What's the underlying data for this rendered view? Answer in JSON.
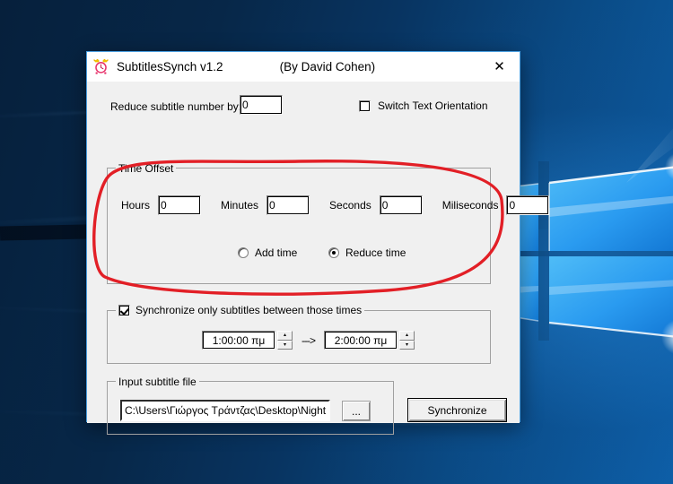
{
  "window": {
    "title": "SubtitlesSynch v1.2",
    "author": "(By David Cohen)",
    "icon": "alarm-clock-icon",
    "close_label": "✕"
  },
  "form": {
    "reduce_subtitle_label": "Reduce subtitle number by:",
    "reduce_subtitle_value": "0",
    "switch_orientation_label": "Switch Text Orientation",
    "switch_orientation_checked": false
  },
  "time_offset": {
    "group_title": "Time Offset",
    "fields": [
      {
        "label": "Hours",
        "value": "0"
      },
      {
        "label": "Minutes",
        "value": "0"
      },
      {
        "label": "Seconds",
        "value": "0"
      },
      {
        "label": "Miliseconds",
        "value": "0"
      }
    ],
    "radio_add_label": "Add time",
    "radio_reduce_label": "Reduce time",
    "selected": "Reduce time"
  },
  "sync_range": {
    "checkbox_label": "Synchronize only subtitles between those times",
    "checked": true,
    "start_time": "1:00:00 πμ",
    "end_time": "2:00:00 πμ",
    "arrow": "--->",
    "spin_up": "▴",
    "spin_down": "▾"
  },
  "input_file": {
    "group_title": "Input subtitle file",
    "path": "C:\\Users\\Γιώργος Τράντζας\\Desktop\\Night Ol",
    "browse_label": "...",
    "synchronize_label": "Synchronize"
  },
  "annotation": {
    "shape": "red-ellipse-highlight",
    "target": "Time Offset",
    "color": "#e21f26"
  },
  "desktop": {
    "wallpaper": "windows-10-hero-logo"
  }
}
